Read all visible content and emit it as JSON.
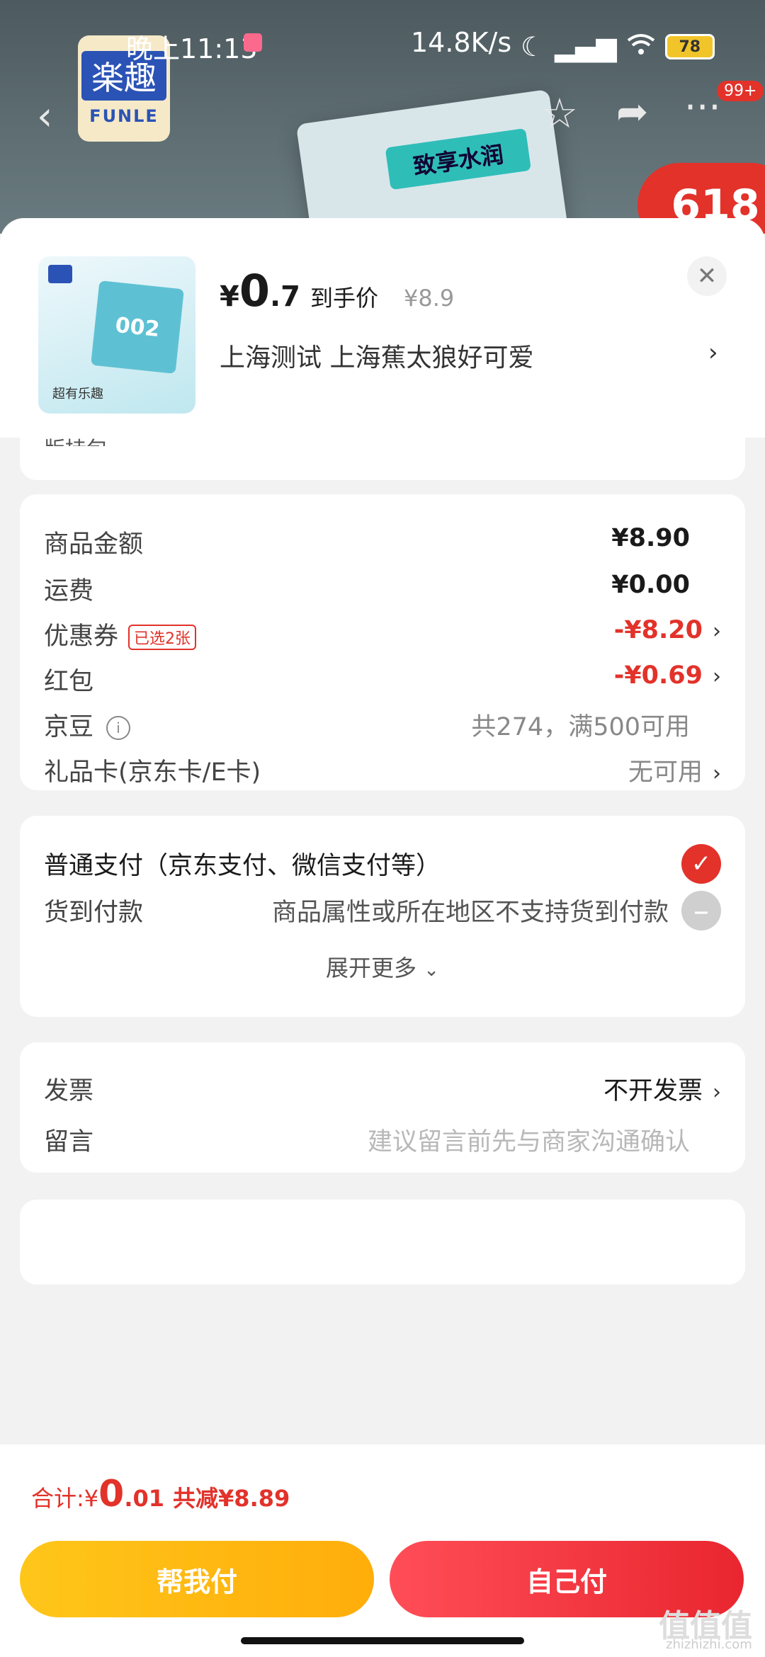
{
  "status_bar": {
    "time": "晚上11:13",
    "speed": "14.8K/s",
    "battery": "78"
  },
  "background": {
    "logo_cn": "楽趣",
    "logo_en": "FUNLE",
    "box_label": "致享水润",
    "promo_badge": "618",
    "more_count": "99+"
  },
  "product": {
    "price_symbol": "¥",
    "price_int": "0",
    "price_dec": ".7",
    "price_label": "到手价",
    "original_price": "¥8.9",
    "address": "上海测试  上海蕉太狼好可爱",
    "thumb_model": "002",
    "thumb_tag": "超有乐趣"
  },
  "stub_text": "版持包",
  "summary": {
    "goods_amount": {
      "label": "商品金额",
      "value": "¥8.90"
    },
    "shipping": {
      "label": "运费",
      "value": "¥0.00"
    },
    "coupon": {
      "label": "优惠券",
      "tag": "已选2张",
      "value": "-¥8.20"
    },
    "red_packet": {
      "label": "红包",
      "value": "-¥0.69"
    },
    "jd_beans": {
      "label": "京豆",
      "value": "共274，满500可用"
    },
    "gift_card": {
      "label": "礼品卡(京东卡/E卡)",
      "value": "无可用"
    }
  },
  "payment": {
    "normal": {
      "label": "普通支付（京东支付、微信支付等）"
    },
    "cod": {
      "label": "货到付款",
      "note": "商品属性或所在地区不支持货到付款"
    },
    "expand": "展开更多"
  },
  "misc": {
    "invoice": {
      "label": "发票",
      "value": "不开发票"
    },
    "message": {
      "label": "留言",
      "placeholder": "建议留言前先与商家沟通确认"
    }
  },
  "footer": {
    "total_label": "合计: ",
    "total_symbol": "¥",
    "total_int": "0",
    "total_dec": ".01",
    "savings": "共减¥8.89",
    "help_pay": "帮我付",
    "self_pay": "自己付"
  },
  "watermark": {
    "main": "值值值",
    "sub": "zhizhizhi.com"
  },
  "colors": {
    "accent_red": "#e2322a",
    "help_yellow": "#ffc61a"
  }
}
